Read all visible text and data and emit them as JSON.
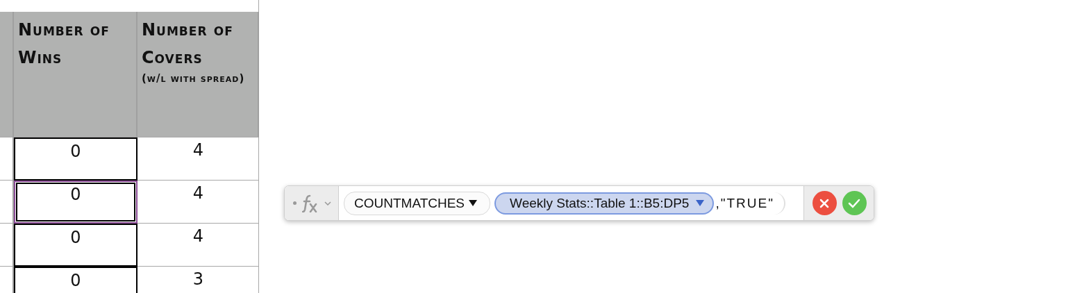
{
  "table": {
    "columns": [
      {
        "label": "Number of Wins"
      },
      {
        "label": "Number of Covers",
        "note": "(w/l with spread)"
      }
    ],
    "rows": [
      {
        "wins": "0",
        "covers": "4",
        "selected": false
      },
      {
        "wins": "0",
        "covers": "4",
        "selected": true
      },
      {
        "wins": "0",
        "covers": "4",
        "selected": false
      },
      {
        "wins": "0",
        "covers": "3",
        "selected": false
      }
    ]
  },
  "formula_editor": {
    "function": "COUNTMATCHES",
    "reference": "Weekly Stats::Table 1::B5:DP5",
    "literal": ",\"TRUE\""
  }
}
